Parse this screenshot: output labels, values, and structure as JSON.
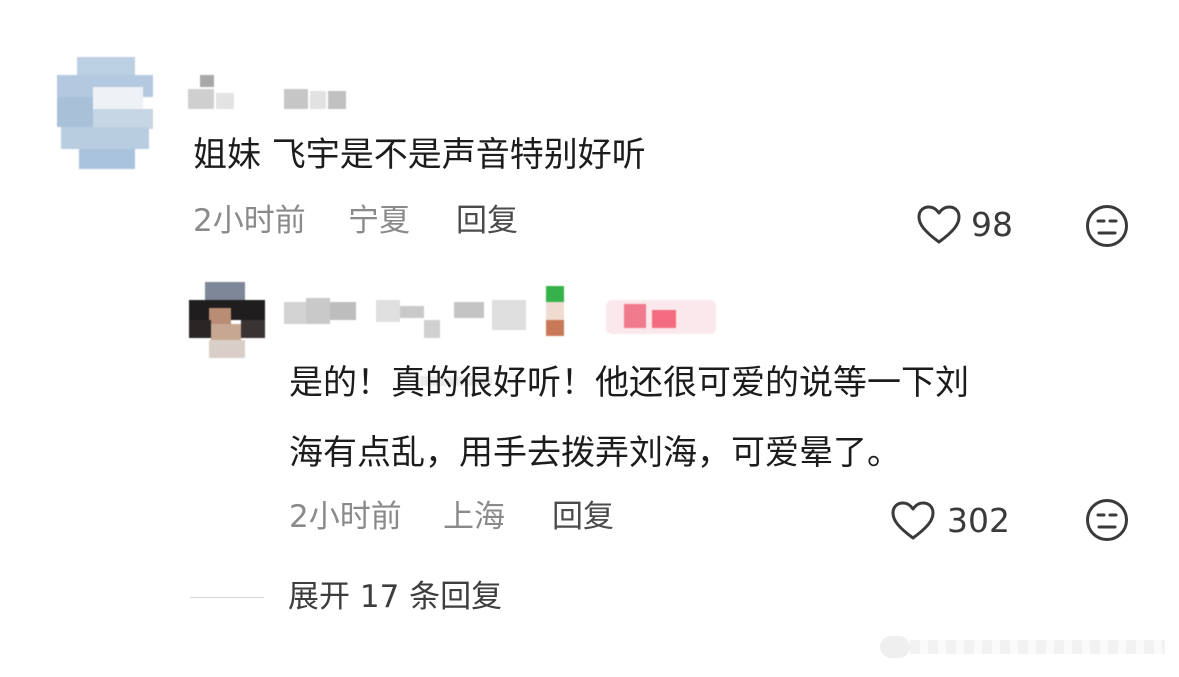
{
  "comments": [
    {
      "text": "姐妹 飞宇是不是声音特别好听",
      "time": "2小时前",
      "location": "宁夏",
      "reply_label": "回复",
      "likes": "98",
      "replies": [
        {
          "text_line1": "是的！真的很好听！他还很可爱的说等一下刘",
          "text_line2": "海有点乱，用手去拨弄刘海，可爱晕了。",
          "time": "2小时前",
          "location": "上海",
          "reply_label": "回复",
          "likes": "302"
        }
      ]
    }
  ],
  "expand_replies_label": "展开 17 条回复",
  "icons": {
    "like": "heart-outline-icon",
    "dislike": "meh-face-icon"
  }
}
